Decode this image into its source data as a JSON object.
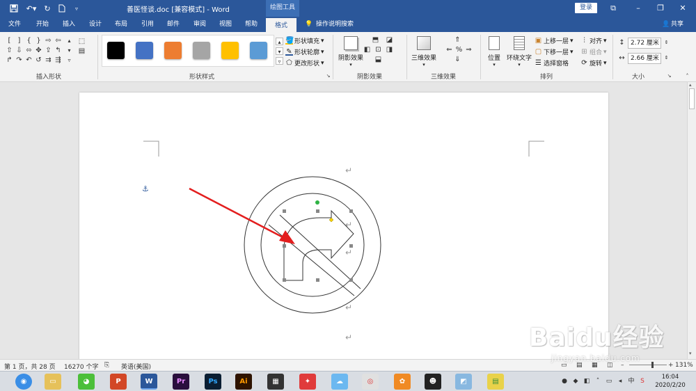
{
  "titlebar": {
    "doc_title": "善医怪谈.doc [兼容模式]  -  Word",
    "context_tool": "绘图工具",
    "login_label": "登录"
  },
  "tabs": [
    "文件",
    "开始",
    "插入",
    "设计",
    "布局",
    "引用",
    "邮件",
    "审阅",
    "视图",
    "帮助",
    "格式"
  ],
  "active_tab": "格式",
  "tell_me": "操作说明搜索",
  "share_label": "共享",
  "ribbon": {
    "insert_shapes_label": "插入形状",
    "shape_styles_label": "形状样式",
    "shape_fill": "形状填充",
    "shape_outline": "形状轮廓",
    "change_shape": "更改形状",
    "shadow_effects_btn": "阴影效果",
    "shadow_effects_label": "阴影效果",
    "threed_btn": "三维效果",
    "threed_label": "三维效果",
    "position": "位置",
    "wrap_text": "环绕文字",
    "bring_forward": "上移一层",
    "send_backward": "下移一层",
    "selection_pane": "选择窗格",
    "align": "对齐",
    "group": "组合",
    "rotate": "旋转",
    "arrange_label": "排列",
    "height_value": "2.72 厘米",
    "width_value": "2.66 厘米",
    "size_label": "大小",
    "swatch_colors": [
      "#000000",
      "#4472c4",
      "#ed7d31",
      "#a5a5a5",
      "#ffc000",
      "#5b9bd5"
    ]
  },
  "status": {
    "page": "第 1 页，共 28 页",
    "words": "16270 个字",
    "language": "英语(美国)",
    "zoom": "131%"
  },
  "taskbar": {
    "time": "16:04",
    "date": "2020/2/20",
    "apps": [
      "browser",
      "explorer",
      "wechat",
      "powerpoint",
      "word",
      "premiere",
      "photoshop",
      "illustrator",
      "video",
      "app-red",
      "app-qq-cloud",
      "chrome",
      "app-orange",
      "qq",
      "app-blue",
      "app-green"
    ]
  },
  "watermark": {
    "text": "Baidu经验",
    "sub": "jingyan.baidu.com"
  },
  "drawing": {
    "annotation_arrow_color": "#e31e1e",
    "outline_color": "#333333"
  }
}
